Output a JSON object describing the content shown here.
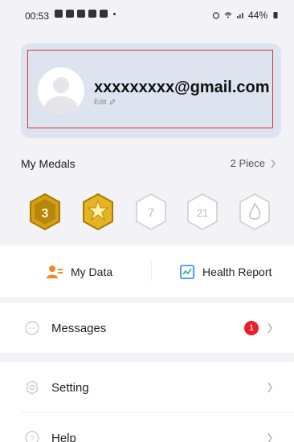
{
  "status_bar": {
    "time": "00:53",
    "battery": "44%"
  },
  "profile": {
    "email": "xxxxxxxxx@gmail.com",
    "edit_label": "Edit"
  },
  "medals": {
    "title": "My Medals",
    "count_label": "2 Piece",
    "items": [
      {
        "icon": "medal-3-gold-icon",
        "earned": true,
        "number": "3"
      },
      {
        "icon": "medal-star-gold-icon",
        "earned": true,
        "number": ""
      },
      {
        "icon": "medal-7-days-icon",
        "earned": false,
        "number": "7"
      },
      {
        "icon": "medal-21-days-icon",
        "earned": false,
        "number": "21"
      },
      {
        "icon": "medal-fire-icon",
        "earned": false,
        "number": ""
      }
    ]
  },
  "quick_links": {
    "my_data": "My Data",
    "health_report": "Health Report"
  },
  "menu": {
    "messages": "Messages",
    "messages_badge": "1",
    "setting": "Setting",
    "help": "Help"
  },
  "colors": {
    "background": "#f2f2f7",
    "card": "#dde3ef",
    "badge": "#e8202a",
    "gold": "#d4a017"
  }
}
